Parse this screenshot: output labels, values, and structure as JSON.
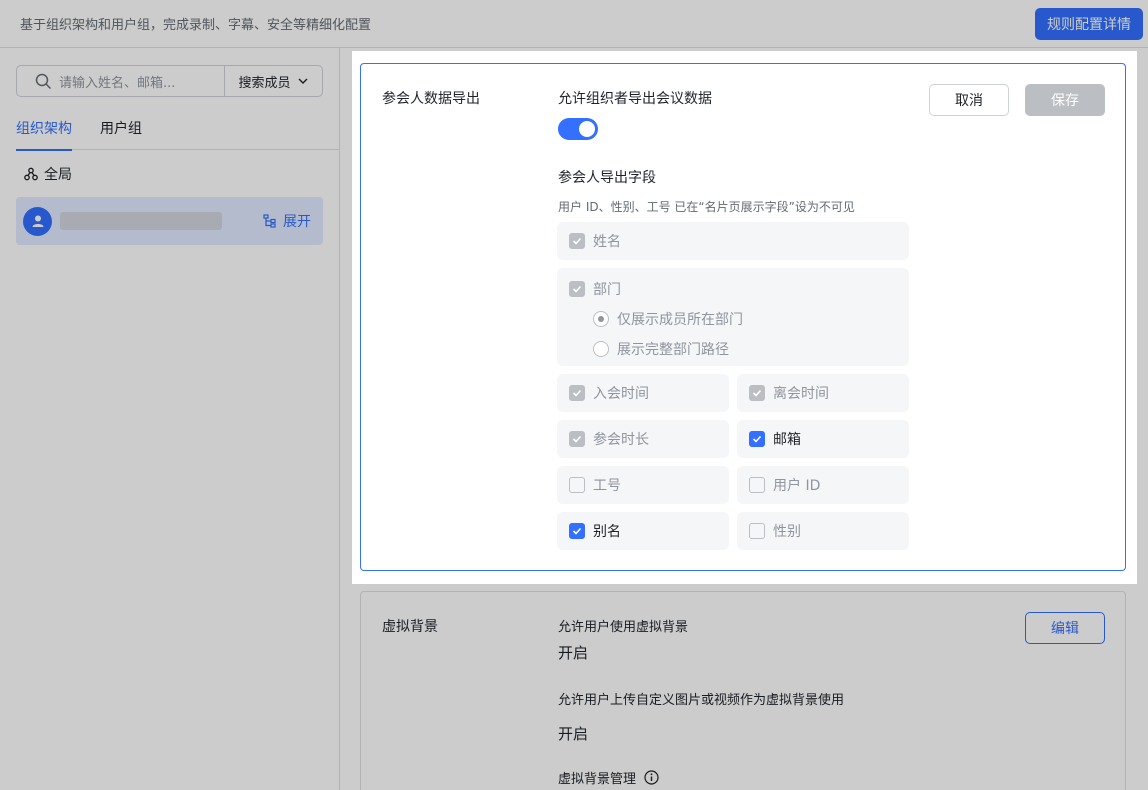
{
  "topbar": {
    "description": "基于组织架构和用户组，完成录制、字幕、安全等精细化配置",
    "rule_detail_button": "规则配置详情"
  },
  "sidebar": {
    "search_placeholder": "请输入姓名、邮箱...",
    "search_type": "搜索成员",
    "tabs": [
      "组织架构",
      "用户组"
    ],
    "active_tab": "组织架构",
    "global_label": "全局",
    "expand_label": "展开"
  },
  "export_card": {
    "title": "参会人数据导出",
    "allow_label": "允许组织者导出会议数据",
    "toggle_on": true,
    "cancel_label": "取消",
    "save_label": "保存",
    "fields_title": "参会人导出字段",
    "fields_note": "用户 ID、性别、工号 已在“名片页展示字段”设为不可见",
    "fields": {
      "name": "姓名",
      "department": "部门",
      "dept_option_1": "仅展示成员所在部门",
      "dept_option_2": "展示完整部门路径",
      "join_time": "入会时间",
      "leave_time": "离会时间",
      "duration": "参会时长",
      "email": "邮箱",
      "employee_id": "工号",
      "user_id": "用户 ID",
      "alias": "别名",
      "gender": "性别"
    }
  },
  "virtual_bg_card": {
    "title": "虚拟背景",
    "allow_label": "允许用户使用虚拟背景",
    "allow_value": "开启",
    "upload_label": "允许用户上传自定义图片或视频作为虚拟背景使用",
    "upload_value": "开启",
    "manage_label": "虚拟背景管理",
    "edit_label": "编辑"
  },
  "colors": {
    "accent": "#3370ff",
    "disabled": "#bbbfc4"
  }
}
